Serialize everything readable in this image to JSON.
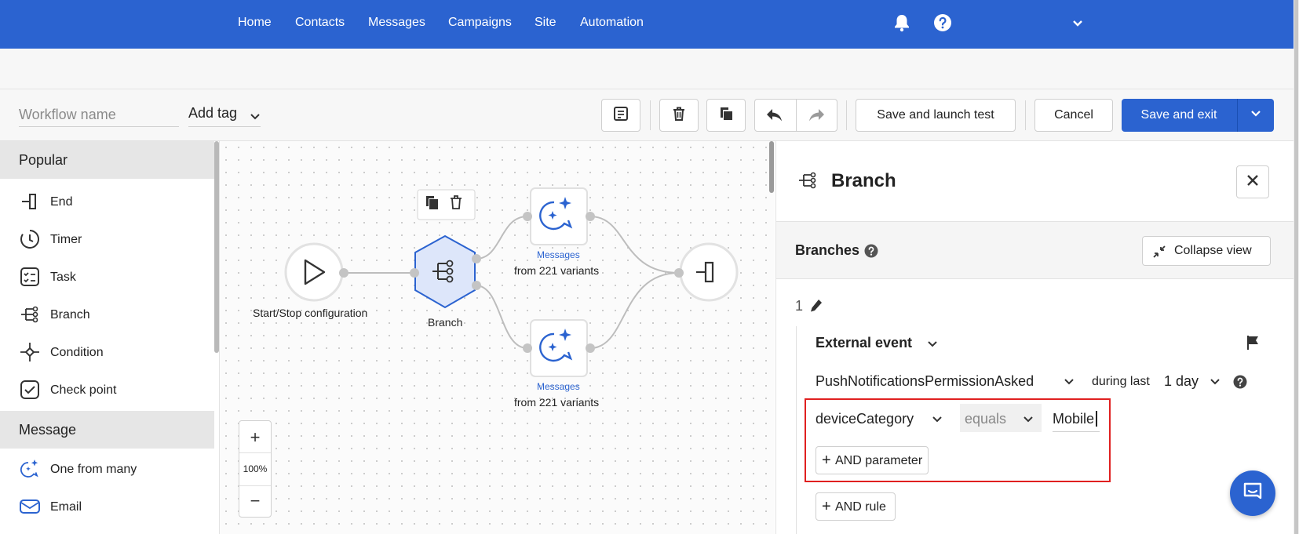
{
  "nav": {
    "items": [
      "Home",
      "Contacts",
      "Messages",
      "Campaigns",
      "Site",
      "Automation"
    ],
    "icons": [
      "bell-icon",
      "help-icon",
      "chevron-down-icon"
    ]
  },
  "toolbar": {
    "workflow_name_placeholder": "Workflow name",
    "add_tag_label": "Add tag",
    "save_launch_label": "Save and launch test",
    "cancel_label": "Cancel",
    "save_exit_label": "Save and exit"
  },
  "palette": {
    "sections": [
      {
        "title": "Popular",
        "items": [
          {
            "label": "End",
            "icon": "end-icon"
          },
          {
            "label": "Timer",
            "icon": "timer-icon"
          },
          {
            "label": "Task",
            "icon": "task-icon"
          },
          {
            "label": "Branch",
            "icon": "branch-icon"
          },
          {
            "label": "Condition",
            "icon": "condition-icon"
          },
          {
            "label": "Check point",
            "icon": "check-point-icon"
          }
        ]
      },
      {
        "title": "Message",
        "items": [
          {
            "label": "One from many",
            "icon": "sparkle-chat-icon"
          },
          {
            "label": "Email",
            "icon": "email-icon"
          }
        ]
      }
    ]
  },
  "canvas": {
    "start_label": "Start/Stop configuration",
    "branch_label": "Branch",
    "msg1_sub": "Messages",
    "msg1_label": "from 221 variants",
    "msg2_sub": "Messages",
    "msg2_label": "from 221 variants",
    "zoom_level": "100%",
    "zoom_in": "+",
    "zoom_out": "−"
  },
  "panel": {
    "title": "Branch",
    "branches_label": "Branches",
    "collapse_label": "Collapse view",
    "branch_index": "1",
    "event_type": "External event",
    "event_name": "PushNotificationsPermissionAsked",
    "during_label": "during last",
    "during_value": "1 day",
    "param_name": "deviceCategory",
    "param_op": "equals",
    "param_value": "Mobile",
    "and_parameter": "AND parameter",
    "and_rule": "AND rule"
  },
  "colors": {
    "brand": "#2b63d0",
    "highlight": "#e02020"
  }
}
